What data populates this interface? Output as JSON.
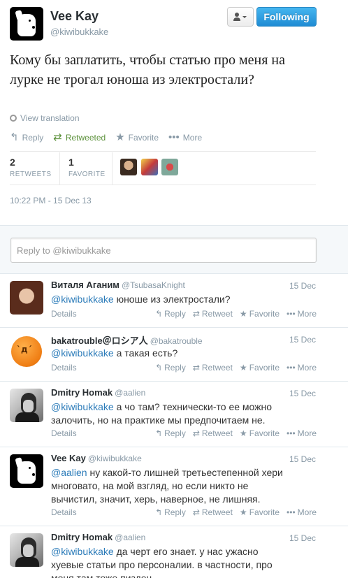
{
  "author": {
    "name": "Vee Kay",
    "handle": "@kiwibukkake",
    "follow_label": "Following",
    "follow_color": "#2b8ed6"
  },
  "tweet": {
    "text": "Кому бы заплатить, чтобы статью про меня на лурке не трогал юноша из электростали?",
    "translate_label": "View translation",
    "actions": {
      "reply": "Reply",
      "retweeted": "Retweeted",
      "favorite": "Favorite",
      "more": "More"
    },
    "stats": {
      "retweets_count": "2",
      "retweets_label": "RETWEETS",
      "favorites_count": "1",
      "favorites_label": "FAVORITE"
    },
    "timestamp": "10:22 PM - 15 Dec 13"
  },
  "reply_box": {
    "prefix": "Reply to ",
    "mention": "@kiwibukkake"
  },
  "reply_actions": {
    "details": "Details",
    "reply": "Reply",
    "retweet": "Retweet",
    "favorite": "Favorite",
    "more": "More"
  },
  "replies": [
    {
      "name": "Виталя Аганим",
      "handle": "@TsubasaKnight",
      "date": "15 Dec",
      "mention": "@kiwibukkake",
      "text": " юноше из электростали?"
    },
    {
      "name": "bakatrouble＠ロシア人",
      "handle": "@bakatrouble",
      "date": "15 Dec",
      "mention": "@kiwibukkake",
      "text": " а такая есть?"
    },
    {
      "name": "Dmitry Homak",
      "handle": "@aalien",
      "date": "15 Dec",
      "mention": "@kiwibukkake",
      "text": " а чо там? технически-то ее можно залочить, но на практике мы предпочитаем не."
    },
    {
      "name": "Vee Kay",
      "handle": "@kiwibukkake",
      "date": "15 Dec",
      "mention": "@aalien",
      "text": " ну какой-то лишней третьестепенной хери многовато, на мой взгляд, но если никто не вычистил, значит, херь, наверное, не лишняя."
    },
    {
      "name": "Dmitry Homak",
      "handle": "@aalien",
      "date": "15 Dec",
      "mention": "@kiwibukkake",
      "text": " да черт его знает. у нас ужасно хуевые статьи про персоналии. в частности, про меня там тоже пиздец."
    }
  ]
}
